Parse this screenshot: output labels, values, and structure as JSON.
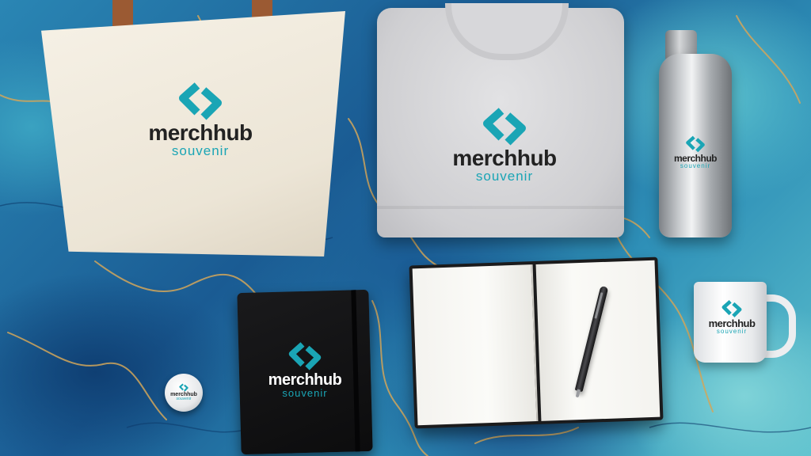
{
  "brand": {
    "name": "merchhub",
    "tagline": "souvenir",
    "accent_color": "#1aa5b5",
    "dark_text_color": "#222222",
    "light_text_color": "#ffffff"
  },
  "scene": {
    "background": "blue and teal marble with gold veins",
    "items": [
      "tote-bag",
      "sweatshirt",
      "water-bottle",
      "mug",
      "black-notebook",
      "button-badge",
      "open-notebook",
      "pen"
    ]
  }
}
